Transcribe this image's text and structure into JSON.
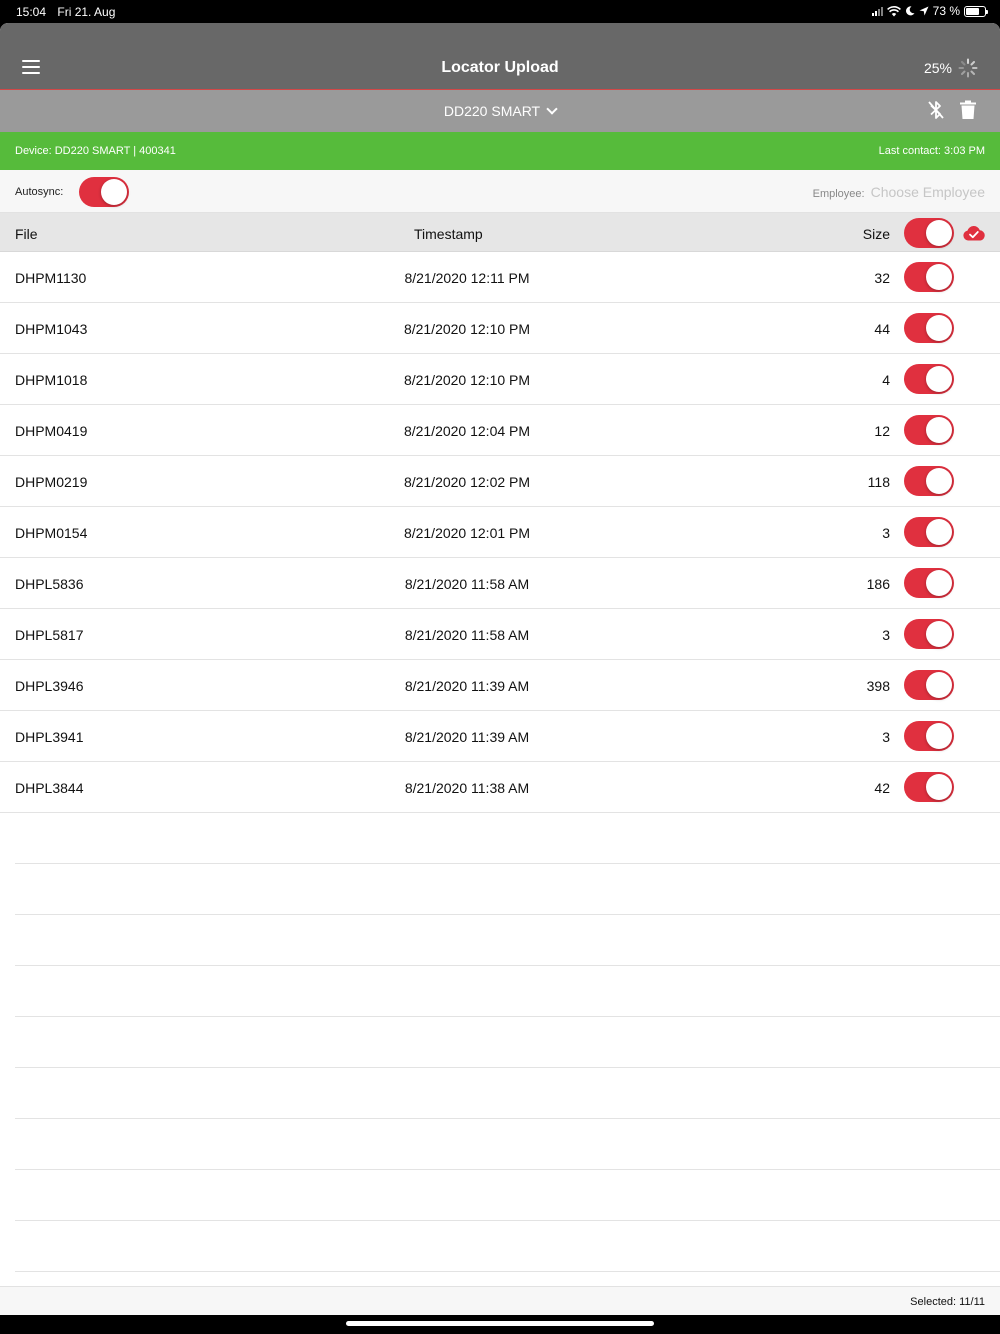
{
  "status_bar": {
    "time": "15:04",
    "date": "Fri 21. Aug",
    "battery_text": "73 %",
    "battery_level": 0.73
  },
  "header": {
    "title": "Locator Upload",
    "progress_text": "25%",
    "progress_value": 0.25
  },
  "device_selector": {
    "selected": "DD220 SMART"
  },
  "device_info": {
    "device": "Device: DD220 SMART | 400341",
    "last_contact": "Last contact: 3:03 PM"
  },
  "autosync": {
    "label": "Autosync:",
    "enabled": true,
    "employee_label": "Employee:",
    "employee_placeholder": "Choose Employee"
  },
  "table": {
    "columns": [
      "File",
      "Timestamp",
      "Size"
    ],
    "select_all": true,
    "rows": [
      {
        "file": "DHPM1130",
        "timestamp": "8/21/2020 12:11 PM",
        "size": "32",
        "selected": true
      },
      {
        "file": "DHPM1043",
        "timestamp": "8/21/2020 12:10 PM",
        "size": "44",
        "selected": true
      },
      {
        "file": "DHPM1018",
        "timestamp": "8/21/2020 12:10 PM",
        "size": "4",
        "selected": true
      },
      {
        "file": "DHPM0419",
        "timestamp": "8/21/2020 12:04 PM",
        "size": "12",
        "selected": true
      },
      {
        "file": "DHPM0219",
        "timestamp": "8/21/2020 12:02 PM",
        "size": "118",
        "selected": true
      },
      {
        "file": "DHPM0154",
        "timestamp": "8/21/2020 12:01 PM",
        "size": "3",
        "selected": true
      },
      {
        "file": "DHPL5836",
        "timestamp": "8/21/2020 11:58 AM",
        "size": "186",
        "selected": true
      },
      {
        "file": "DHPL5817",
        "timestamp": "8/21/2020 11:58 AM",
        "size": "3",
        "selected": true
      },
      {
        "file": "DHPL3946",
        "timestamp": "8/21/2020 11:39 AM",
        "size": "398",
        "selected": true
      },
      {
        "file": "DHPL3941",
        "timestamp": "8/21/2020 11:39 AM",
        "size": "3",
        "selected": true
      },
      {
        "file": "DHPL3844",
        "timestamp": "8/21/2020 11:38 AM",
        "size": "42",
        "selected": true
      }
    ]
  },
  "footer": {
    "selected_text": "Selected: 11/11"
  },
  "colors": {
    "accent_red": "#e0303f",
    "status_green": "#56bb3b",
    "header_gray": "#686868",
    "subheader_gray": "#9a9a9a"
  },
  "icons": {
    "menu": "hamburger-menu-icon",
    "spinner": "loading-spinner-icon",
    "device_dropdown": "chevron-down-icon",
    "bluetooth": "bluetooth-disabled-icon",
    "delete": "trash-icon",
    "cloud": "cloud-check-icon"
  }
}
